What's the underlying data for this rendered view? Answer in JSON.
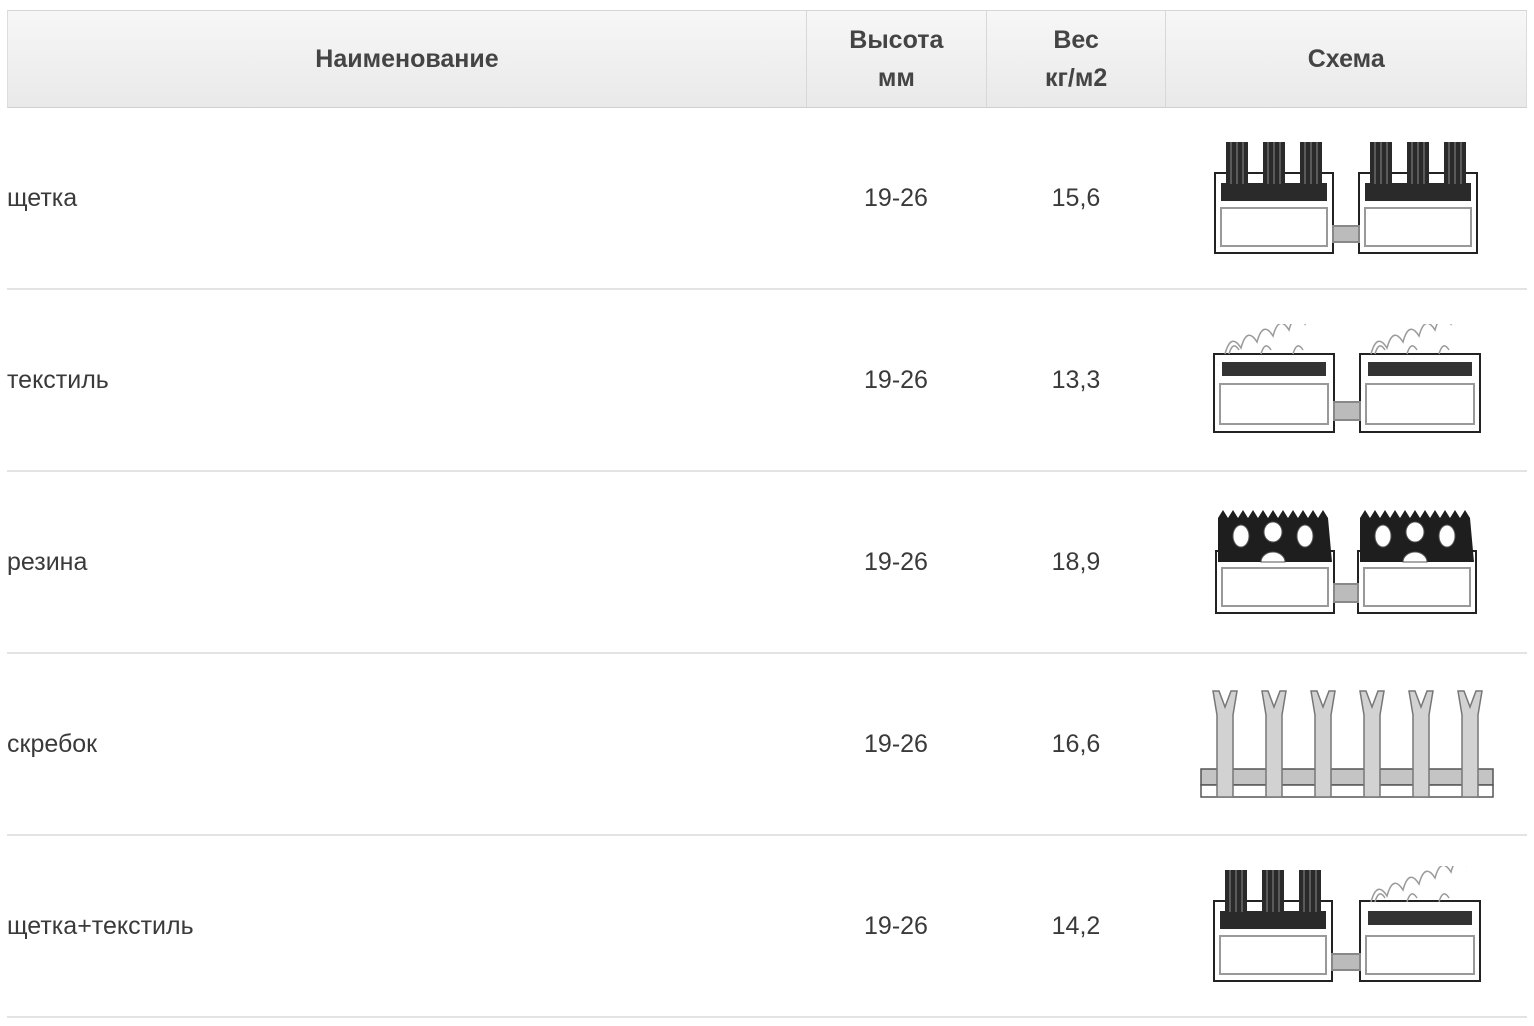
{
  "table": {
    "headers": {
      "name": "Наименование",
      "height_line1": "Высота",
      "height_line2": "мм",
      "weight_line1": "Вес",
      "weight_line2": "кг/м2",
      "schema": "Схема"
    },
    "rows": [
      {
        "name": "щетка",
        "height": "19-26",
        "weight": "15,6",
        "schema_icon": "brush-mat-diagram"
      },
      {
        "name": "текстиль",
        "height": "19-26",
        "weight": "13,3",
        "schema_icon": "textile-mat-diagram"
      },
      {
        "name": "резина",
        "height": "19-26",
        "weight": "18,9",
        "schema_icon": "rubber-mat-diagram"
      },
      {
        "name": "скребок",
        "height": "19-26",
        "weight": "16,6",
        "schema_icon": "scraper-mat-diagram"
      },
      {
        "name": "щетка+текстиль",
        "height": "19-26",
        "weight": "14,2",
        "schema_icon": "brush-textile-mat-diagram"
      }
    ]
  }
}
